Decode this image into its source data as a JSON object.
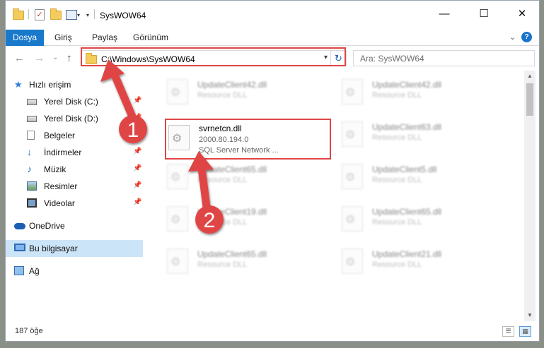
{
  "window": {
    "title": "SysWOW64",
    "controls": {
      "minimize": "—",
      "maximize": "☐",
      "close": "✕"
    }
  },
  "ribbon": {
    "tabs": [
      "Dosya",
      "Giriş",
      "Paylaş",
      "Görünüm"
    ],
    "help": "?"
  },
  "nav": {
    "back": "←",
    "forward": "→",
    "recent": "⌄",
    "up": "↑",
    "address": "C:\\Windows\\SysWOW64",
    "search_placeholder": "Ara: SysWOW64"
  },
  "sidebar": {
    "items": [
      {
        "label": "Hızlı erişim",
        "icon": "star-icon"
      },
      {
        "label": "Yerel Disk (C:)",
        "icon": "drive-icon",
        "pinned": true
      },
      {
        "label": "Yerel Disk (D:)",
        "icon": "drive-icon",
        "pinned": true
      },
      {
        "label": "Belgeler",
        "icon": "document-icon",
        "pinned": true
      },
      {
        "label": "İndirmeler",
        "icon": "download-icon",
        "pinned": true
      },
      {
        "label": "Müzik",
        "icon": "music-icon",
        "pinned": true
      },
      {
        "label": "Resimler",
        "icon": "picture-icon",
        "pinned": true
      },
      {
        "label": "Videolar",
        "icon": "video-icon",
        "pinned": true
      },
      {
        "label": "OneDrive",
        "icon": "cloud-icon"
      },
      {
        "label": "Bu bilgisayar",
        "icon": "computer-icon",
        "selected": true
      },
      {
        "label": "Ağ",
        "icon": "network-icon"
      }
    ]
  },
  "files": [
    {
      "name": "UpdateClient42.dll",
      "type": "Resource DLL"
    },
    {
      "name": "UpdateClient42.dll",
      "type": "Resource DLL"
    },
    {
      "name": "svrnetcn.dll",
      "version": "2000.80.194.0",
      "description": "SQL Server Network ..."
    },
    {
      "name": "UpdateClient63.dll",
      "type": "Resource DLL"
    },
    {
      "name": "UpdateClient65.dll",
      "type": "Resource DLL"
    },
    {
      "name": "UpdateClient5.dll",
      "type": "Resource DLL"
    },
    {
      "name": "UpdateClient19.dll",
      "type": "Resource DLL"
    },
    {
      "name": "UpdateClient65.dll",
      "type": "Resource DLL"
    },
    {
      "name": "UpdateClient65.dll",
      "type": "Resource DLL"
    },
    {
      "name": "UpdateClient21.dll",
      "type": "Resource DLL"
    }
  ],
  "status": {
    "item_count": "187 öğe"
  },
  "annotations": {
    "step1": "1",
    "step2": "2",
    "color": "#e04545"
  }
}
